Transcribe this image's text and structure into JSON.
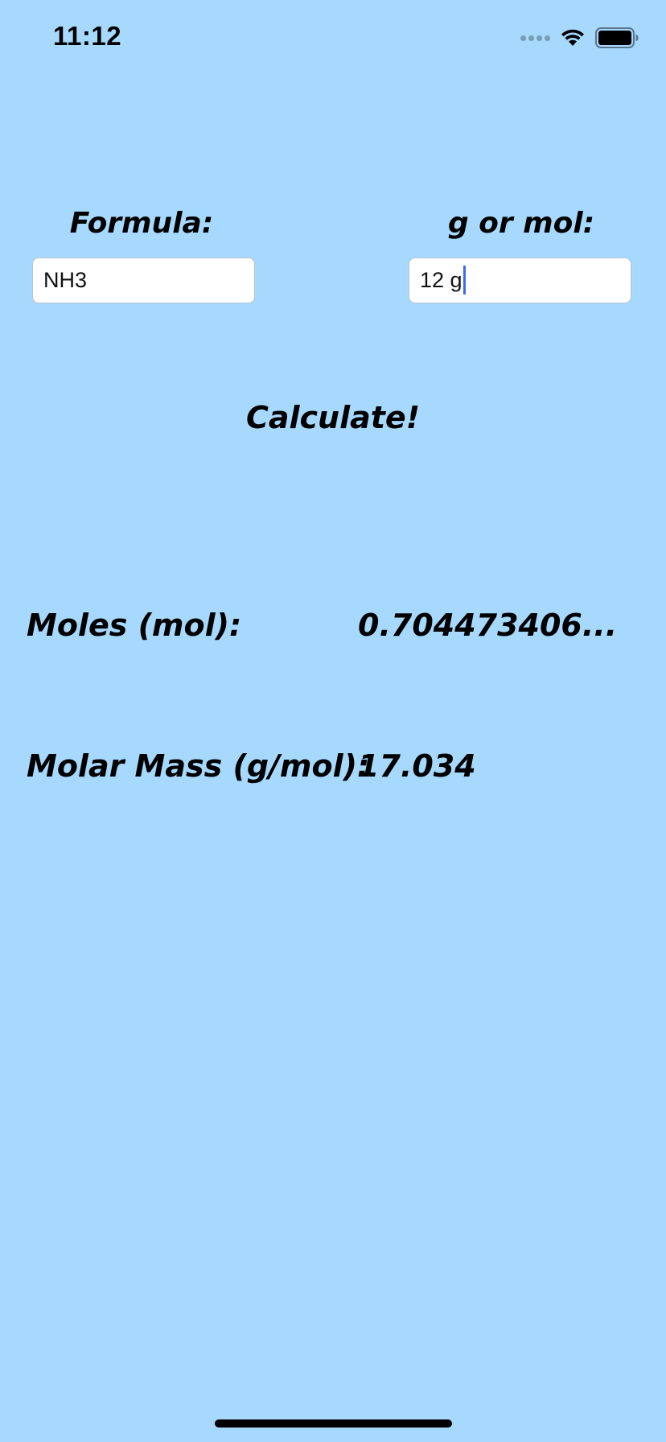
{
  "status_bar": {
    "time": "11:12",
    "icons": [
      "cellular-signal-icon",
      "wifi-icon",
      "battery-icon"
    ]
  },
  "form": {
    "formula_label": "Formula:",
    "formula_value": "NH3",
    "amount_label": "g or mol:",
    "amount_value": "12 g"
  },
  "actions": {
    "calculate_label": "Calculate!"
  },
  "results": {
    "moles_label": "Moles (mol):",
    "moles_value": "0.704473406...",
    "molar_mass_label": "Molar Mass (g/mol):",
    "molar_mass_value": "17.034"
  },
  "colors": {
    "background": "#a7d8fd",
    "cursor": "#3b6cf0"
  }
}
